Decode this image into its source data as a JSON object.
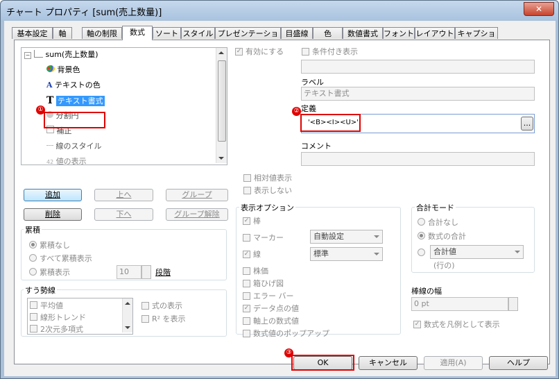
{
  "window": {
    "title": "チャート プロパティ [sum(売上数量)]",
    "close_glyph": "✕"
  },
  "tabs": [
    "基本設定",
    "軸",
    "軸の制限",
    "数式",
    "ソート",
    "スタイル",
    "プレゼンテーション",
    "目盛線",
    "色",
    "数値書式",
    "フォント",
    "レイアウト",
    "キャプション"
  ],
  "active_tab": "数式",
  "tree": {
    "root": "sum(売上数量)",
    "items": [
      "背景色",
      "テキストの色",
      "テキスト書式",
      "分割円",
      "補正",
      "線のスタイル",
      "値の表示"
    ],
    "selected": "テキスト書式"
  },
  "formula_buttons": {
    "add": "追加",
    "up": "上へ",
    "group": "グループ",
    "delete": "削除",
    "down": "下へ",
    "ungroup": "グループ解除"
  },
  "accumulation": {
    "title": "累積",
    "none": "累積なし",
    "all": "すべて累積表示",
    "show": "累積表示",
    "steps_value": "10",
    "steps_label": "段階"
  },
  "trendline": {
    "title": "すう勢線",
    "items": [
      "平均値",
      "線形トレンド",
      "2次元多項式"
    ],
    "show_formula": "式の表示",
    "show_r2": "R² を表示"
  },
  "top_right": {
    "enabled": "有効にする",
    "conditional": "条件付き表示",
    "label_caption": "ラベル",
    "label_value": "テキスト書式",
    "definition_caption": "定義",
    "definition_value": "'<B><I><U>'",
    "ellipsis": "...",
    "comment_caption": "コメント",
    "relative": "相対値表示",
    "invisible": "表示しない"
  },
  "display_options": {
    "title": "表示オプション",
    "bar": "棒",
    "marker": "マーカー",
    "line": "線",
    "marker_combo": "自動設定",
    "line_combo": "標準",
    "stock": "株価",
    "box": "箱ひげ図",
    "error": "エラー バー",
    "values_on_data": "データ点の値",
    "axis_values": "軸上の数式値",
    "popup": "数式値のポップアップ"
  },
  "total_mode": {
    "title": "合計モード",
    "none": "合計なし",
    "expr_total": "数式の合計",
    "total_of": "合計値",
    "rows": "(行の)"
  },
  "line_width": {
    "title": "棒線の幅",
    "value": "0 pt"
  },
  "expression_in_legend": "数式を凡例として表示",
  "dialog_buttons": {
    "ok": "OK",
    "cancel": "キャンセル",
    "apply": "適用(A)",
    "help": "ヘルプ"
  },
  "callouts": [
    "①",
    "②",
    "③"
  ]
}
